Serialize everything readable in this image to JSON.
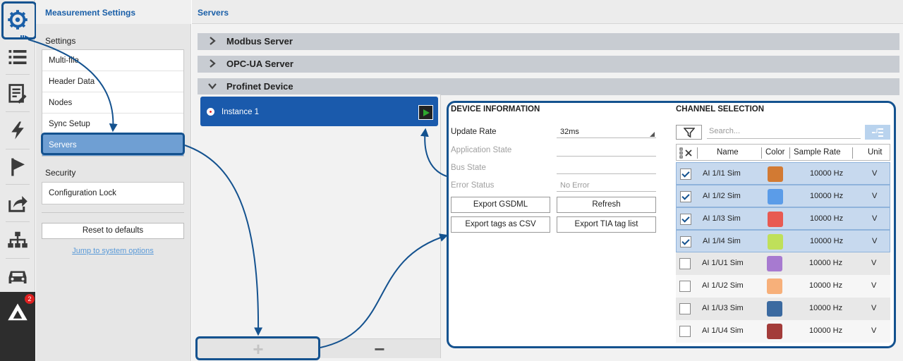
{
  "settings": {
    "title": "Measurement Settings",
    "settings_label": "Settings",
    "items": [
      {
        "label": "Multi-file"
      },
      {
        "label": "Header Data"
      },
      {
        "label": "Nodes"
      },
      {
        "label": "Sync Setup"
      },
      {
        "label": "Servers"
      }
    ],
    "security_label": "Security",
    "security_items": [
      {
        "label": "Configuration Lock"
      }
    ],
    "reset_label": "Reset to defaults",
    "jump_link": "Jump to system options"
  },
  "rail": {
    "badge_count": "2",
    "icons": [
      "gear-icon",
      "list-icon",
      "report-icon",
      "lightning-icon",
      "flag-icon",
      "share-icon",
      "network-icon",
      "car-icon",
      "logo-icon"
    ]
  },
  "main": {
    "title": "Servers",
    "sections": [
      {
        "label": "Modbus Server",
        "expanded": false
      },
      {
        "label": "OPC-UA Server",
        "expanded": false
      },
      {
        "label": "Profinet Device",
        "expanded": true
      }
    ],
    "instances": [
      {
        "label": "Instance 1"
      }
    ],
    "add_label": "+",
    "remove_label": "−"
  },
  "device": {
    "title": "DEVICE INFORMATION",
    "update_rate_label": "Update Rate",
    "update_rate_value": "32ms",
    "application_state_label": "Application State",
    "application_state_value": "",
    "bus_state_label": "Bus State",
    "bus_state_value": "",
    "error_status_label": "Error Status",
    "error_status_value": "No Error",
    "buttons": {
      "export_gsdml": "Export GSDML",
      "refresh": "Refresh",
      "export_csv": "Export tags as CSV",
      "export_tia": "Export TIA tag list"
    }
  },
  "channels": {
    "title": "CHANNEL SELECTION",
    "search_placeholder": "Search...",
    "columns": [
      "Name",
      "Color",
      "Sample Rate",
      "Unit"
    ],
    "rows": [
      {
        "name": "AI 1/I1 Sim",
        "color": "#d27a33",
        "rate": "10000 Hz",
        "unit": "V",
        "checked": true
      },
      {
        "name": "AI 1/I2 Sim",
        "color": "#5b9ce8",
        "rate": "10000 Hz",
        "unit": "V",
        "checked": true
      },
      {
        "name": "AI 1/I3 Sim",
        "color": "#e85a52",
        "rate": "10000 Hz",
        "unit": "V",
        "checked": true
      },
      {
        "name": "AI 1/I4 Sim",
        "color": "#bfe05a",
        "rate": "10000 Hz",
        "unit": "V",
        "checked": true
      },
      {
        "name": "AI 1/U1 Sim",
        "color": "#a77ad0",
        "rate": "10000 Hz",
        "unit": "V",
        "checked": false
      },
      {
        "name": "AI 1/U2 Sim",
        "color": "#f7b07a",
        "rate": "10000 Hz",
        "unit": "V",
        "checked": false
      },
      {
        "name": "AI 1/U3 Sim",
        "color": "#3b6aa0",
        "rate": "10000 Hz",
        "unit": "V",
        "checked": false
      },
      {
        "name": "AI 1/U4 Sim",
        "color": "#a33c3a",
        "rate": "10000 Hz",
        "unit": "V",
        "checked": false
      }
    ]
  },
  "colors": {
    "accent": "#1a5fa8",
    "highlight_outline": "#14528f",
    "selected_row": "#c7d9ee",
    "instance_bg": "#1a5aac"
  }
}
